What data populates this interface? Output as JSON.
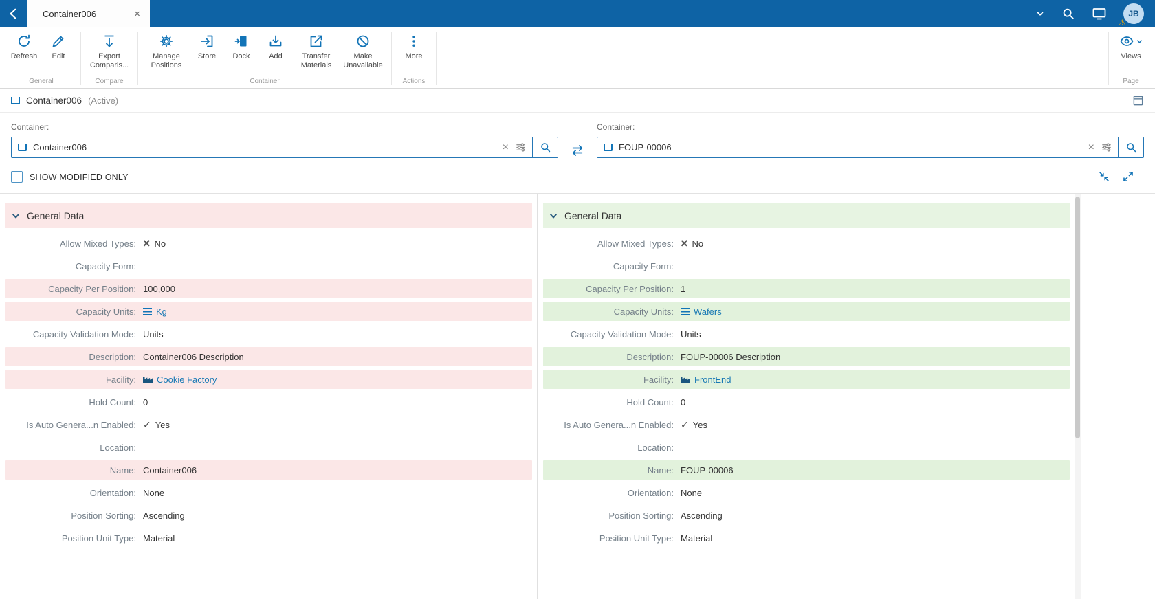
{
  "colors": {
    "topbar_bg": "#0e63a5",
    "icon_blue": "#1274b7",
    "link_blue": "#1979b4",
    "modified_left_bg": "#fbe7e7",
    "modified_right_bg": "#e2f2dc",
    "header_left_bg": "#fbe7e7",
    "header_right_bg": "#e7f4e2"
  },
  "topbar": {
    "tab_title": "Container006",
    "avatar_initials": "JB"
  },
  "toolbar": {
    "groups": [
      {
        "label": "General",
        "buttons": [
          {
            "label": "Refresh",
            "icon": "refresh-icon"
          },
          {
            "label": "Edit",
            "icon": "edit-icon"
          }
        ]
      },
      {
        "label": "Compare",
        "buttons": [
          {
            "label": "Export Comparis...",
            "icon": "export-comparison-icon"
          }
        ]
      },
      {
        "label": "Container",
        "buttons": [
          {
            "label": "Manage Positions",
            "icon": "manage-positions-icon"
          },
          {
            "label": "Store",
            "icon": "store-icon"
          },
          {
            "label": "Dock",
            "icon": "dock-icon"
          },
          {
            "label": "Add",
            "icon": "add-icon"
          },
          {
            "label": "Transfer Materials",
            "icon": "transfer-materials-icon"
          },
          {
            "label": "Make Unavailable",
            "icon": "make-unavailable-icon"
          }
        ]
      },
      {
        "label": "Actions",
        "buttons": [
          {
            "label": "More",
            "icon": "more-icon"
          }
        ]
      }
    ],
    "page_group": {
      "label": "Page",
      "button_label": "Views",
      "icon": "views-icon"
    }
  },
  "entity_header": {
    "title": "Container006",
    "status": "(Active)"
  },
  "selectors": {
    "left": {
      "label": "Container:",
      "value": "Container006"
    },
    "right": {
      "label": "Container:",
      "value": "FOUP-00006"
    }
  },
  "filters": {
    "show_modified_label": "SHOW MODIFIED ONLY",
    "checked": false
  },
  "panels": [
    {
      "side": "left",
      "section_title": "General Data",
      "rows": [
        {
          "label": "Allow Mixed Types:",
          "value": "No",
          "icon": "cross-icon",
          "modified": false
        },
        {
          "label": "Capacity Form:",
          "value": "",
          "modified": false
        },
        {
          "label": "Capacity Per Position:",
          "value": "100,000",
          "modified": true
        },
        {
          "label": "Capacity Units:",
          "value": "Kg",
          "icon": "list-icon",
          "link": true,
          "modified": true
        },
        {
          "label": "Capacity Validation Mode:",
          "value": "Units",
          "modified": false
        },
        {
          "label": "Description:",
          "value": "Container006 Description",
          "modified": true
        },
        {
          "label": "Facility:",
          "value": "Cookie Factory",
          "icon": "facility-icon",
          "link": true,
          "modified": true
        },
        {
          "label": "Hold Count:",
          "value": "0",
          "modified": false
        },
        {
          "label": "Is Auto Genera...n Enabled:",
          "value": "Yes",
          "icon": "check-icon",
          "modified": false
        },
        {
          "label": "Location:",
          "value": "",
          "modified": false
        },
        {
          "label": "Name:",
          "value": "Container006",
          "modified": true
        },
        {
          "label": "Orientation:",
          "value": "None",
          "modified": false
        },
        {
          "label": "Position Sorting:",
          "value": "Ascending",
          "modified": false
        },
        {
          "label": "Position Unit Type:",
          "value": "Material",
          "modified": false
        }
      ]
    },
    {
      "side": "right",
      "section_title": "General Data",
      "rows": [
        {
          "label": "Allow Mixed Types:",
          "value": "No",
          "icon": "cross-icon",
          "modified": false
        },
        {
          "label": "Capacity Form:",
          "value": "",
          "modified": false
        },
        {
          "label": "Capacity Per Position:",
          "value": "1",
          "modified": true
        },
        {
          "label": "Capacity Units:",
          "value": "Wafers",
          "icon": "list-icon",
          "link": true,
          "modified": true
        },
        {
          "label": "Capacity Validation Mode:",
          "value": "Units",
          "modified": false
        },
        {
          "label": "Description:",
          "value": "FOUP-00006 Description",
          "modified": true
        },
        {
          "label": "Facility:",
          "value": "FrontEnd",
          "icon": "facility-icon",
          "link": true,
          "modified": true
        },
        {
          "label": "Hold Count:",
          "value": "0",
          "modified": false
        },
        {
          "label": "Is Auto Genera...n Enabled:",
          "value": "Yes",
          "icon": "check-icon",
          "modified": false
        },
        {
          "label": "Location:",
          "value": "",
          "modified": false
        },
        {
          "label": "Name:",
          "value": "FOUP-00006",
          "modified": true
        },
        {
          "label": "Orientation:",
          "value": "None",
          "modified": false
        },
        {
          "label": "Position Sorting:",
          "value": "Ascending",
          "modified": false
        },
        {
          "label": "Position Unit Type:",
          "value": "Material",
          "modified": false
        }
      ]
    }
  ]
}
